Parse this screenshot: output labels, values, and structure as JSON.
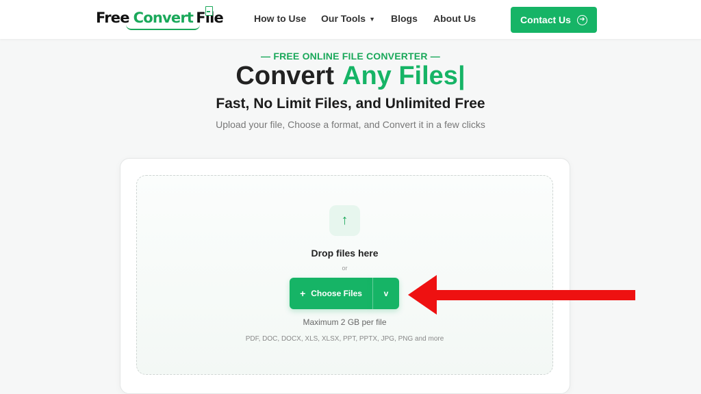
{
  "brand": {
    "word1": "Free",
    "word2": "Convert",
    "word3": "File"
  },
  "nav": {
    "how_to_use": "How to Use",
    "our_tools": "Our Tools",
    "our_tools_caret": "▼",
    "blogs": "Blogs",
    "about_us": "About Us",
    "contact": "Contact Us",
    "contact_icon": "➜"
  },
  "hero": {
    "eyebrow": "— FREE ONLINE FILE CONVERTER —",
    "title_dark": "Convert",
    "title_green": "Any Files|",
    "subtitle": "Fast, No Limit Files, and Unlimited Free",
    "tagline": "Upload your file, Choose a format, and Convert it in a few clicks"
  },
  "upload": {
    "icon_glyph": "↑",
    "drop_text": "Drop files here",
    "or_text": "or",
    "choose_plus": "+",
    "choose_label": "Choose Files",
    "dropdown_label": "v",
    "max_size": "Maximum 2 GB per file",
    "formats": "PDF, DOC, DOCX, XLS, XLSX, PPT, PPTX, JPG, PNG and more"
  },
  "colors": {
    "accent": "#16b466",
    "annotation": "#ee1111"
  },
  "icons": {
    "upload": "upload-arrow-icon",
    "contact": "arrow-circle-right-icon",
    "dropdown": "chevron-down-icon",
    "annotation": "red-pointer-arrow"
  }
}
